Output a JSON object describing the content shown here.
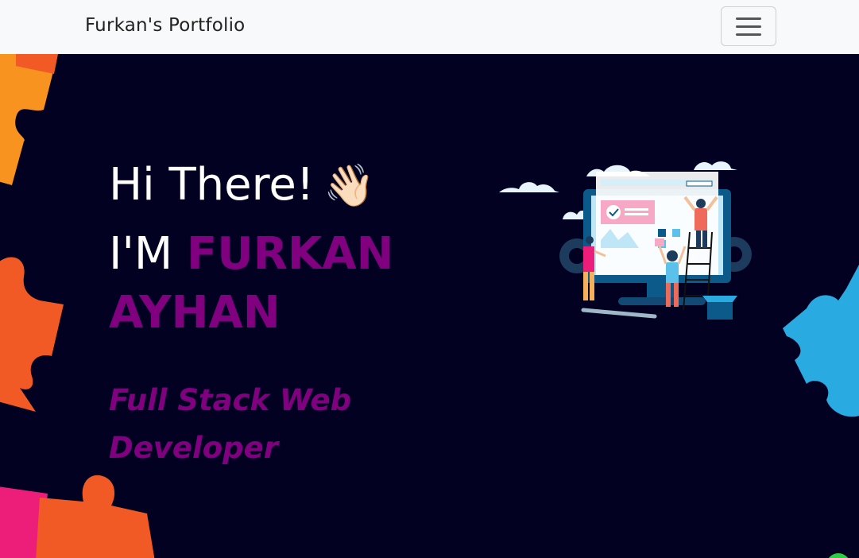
{
  "navbar": {
    "brand": "Furkan's Portfolio",
    "menu_toggle_icon": "hamburger-icon"
  },
  "hero": {
    "greeting": "Hi There!",
    "wave_emoji": "👋🏻",
    "name_prefix": "I'M",
    "name_first": "FURKAN",
    "name_last": "AYHAN",
    "role": "Full Stack Web Developer"
  },
  "colors": {
    "background": "#020122",
    "accent": "#800080",
    "navbar_bg": "#f8f9fa"
  }
}
